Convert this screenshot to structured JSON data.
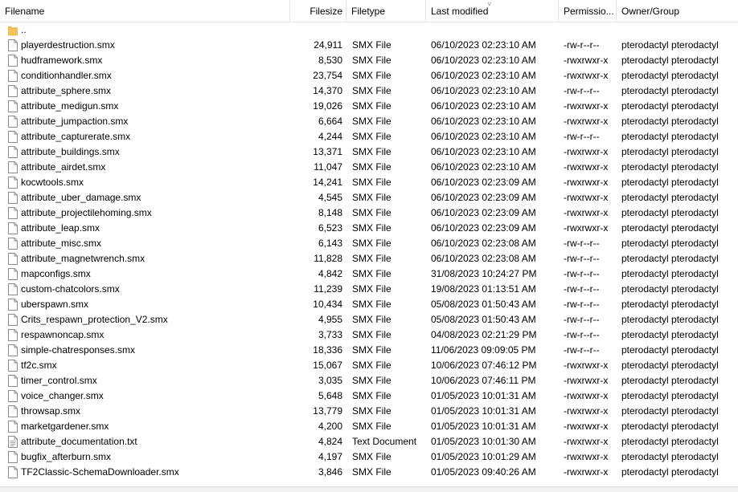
{
  "columns": {
    "filename": "Filename",
    "filesize": "Filesize",
    "filetype": "Filetype",
    "last_modified": "Last modified",
    "permissions": "Permissio...",
    "owner_group": "Owner/Group"
  },
  "sort_indicator": "˅",
  "parent_dir": "..",
  "files": [
    {
      "name": "playerdestruction.smx",
      "size": "24,911",
      "type": "SMX File",
      "modified": "06/10/2023 02:23:10 AM",
      "perm": "-rw-r--r--",
      "owner": "pterodactyl pterodactyl"
    },
    {
      "name": "hudframework.smx",
      "size": "8,530",
      "type": "SMX File",
      "modified": "06/10/2023 02:23:10 AM",
      "perm": "-rwxrwxr-x",
      "owner": "pterodactyl pterodactyl"
    },
    {
      "name": "conditionhandler.smx",
      "size": "23,754",
      "type": "SMX File",
      "modified": "06/10/2023 02:23:10 AM",
      "perm": "-rwxrwxr-x",
      "owner": "pterodactyl pterodactyl"
    },
    {
      "name": "attribute_sphere.smx",
      "size": "14,370",
      "type": "SMX File",
      "modified": "06/10/2023 02:23:10 AM",
      "perm": "-rw-r--r--",
      "owner": "pterodactyl pterodactyl"
    },
    {
      "name": "attribute_medigun.smx",
      "size": "19,026",
      "type": "SMX File",
      "modified": "06/10/2023 02:23:10 AM",
      "perm": "-rwxrwxr-x",
      "owner": "pterodactyl pterodactyl"
    },
    {
      "name": "attribute_jumpaction.smx",
      "size": "6,664",
      "type": "SMX File",
      "modified": "06/10/2023 02:23:10 AM",
      "perm": "-rwxrwxr-x",
      "owner": "pterodactyl pterodactyl"
    },
    {
      "name": "attribute_capturerate.smx",
      "size": "4,244",
      "type": "SMX File",
      "modified": "06/10/2023 02:23:10 AM",
      "perm": "-rw-r--r--",
      "owner": "pterodactyl pterodactyl"
    },
    {
      "name": "attribute_buildings.smx",
      "size": "13,371",
      "type": "SMX File",
      "modified": "06/10/2023 02:23:10 AM",
      "perm": "-rwxrwxr-x",
      "owner": "pterodactyl pterodactyl"
    },
    {
      "name": "attribute_airdet.smx",
      "size": "11,047",
      "type": "SMX File",
      "modified": "06/10/2023 02:23:10 AM",
      "perm": "-rwxrwxr-x",
      "owner": "pterodactyl pterodactyl"
    },
    {
      "name": "kocwtools.smx",
      "size": "14,241",
      "type": "SMX File",
      "modified": "06/10/2023 02:23:09 AM",
      "perm": "-rwxrwxr-x",
      "owner": "pterodactyl pterodactyl"
    },
    {
      "name": "attribute_uber_damage.smx",
      "size": "4,545",
      "type": "SMX File",
      "modified": "06/10/2023 02:23:09 AM",
      "perm": "-rwxrwxr-x",
      "owner": "pterodactyl pterodactyl"
    },
    {
      "name": "attribute_projectilehoming.smx",
      "size": "8,148",
      "type": "SMX File",
      "modified": "06/10/2023 02:23:09 AM",
      "perm": "-rwxrwxr-x",
      "owner": "pterodactyl pterodactyl"
    },
    {
      "name": "attribute_leap.smx",
      "size": "6,523",
      "type": "SMX File",
      "modified": "06/10/2023 02:23:09 AM",
      "perm": "-rwxrwxr-x",
      "owner": "pterodactyl pterodactyl"
    },
    {
      "name": "attribute_misc.smx",
      "size": "6,143",
      "type": "SMX File",
      "modified": "06/10/2023 02:23:08 AM",
      "perm": "-rw-r--r--",
      "owner": "pterodactyl pterodactyl"
    },
    {
      "name": "attribute_magnetwrench.smx",
      "size": "11,828",
      "type": "SMX File",
      "modified": "06/10/2023 02:23:08 AM",
      "perm": "-rw-r--r--",
      "owner": "pterodactyl pterodactyl"
    },
    {
      "name": "mapconfigs.smx",
      "size": "4,842",
      "type": "SMX File",
      "modified": "31/08/2023 10:24:27 PM",
      "perm": "-rw-r--r--",
      "owner": "pterodactyl pterodactyl"
    },
    {
      "name": "custom-chatcolors.smx",
      "size": "11,239",
      "type": "SMX File",
      "modified": "19/08/2023 01:13:51 AM",
      "perm": "-rw-r--r--",
      "owner": "pterodactyl pterodactyl"
    },
    {
      "name": "uberspawn.smx",
      "size": "10,434",
      "type": "SMX File",
      "modified": "05/08/2023 01:50:43 AM",
      "perm": "-rw-r--r--",
      "owner": "pterodactyl pterodactyl"
    },
    {
      "name": "Crits_respawn_protection_V2.smx",
      "size": "4,955",
      "type": "SMX File",
      "modified": "05/08/2023 01:50:43 AM",
      "perm": "-rw-r--r--",
      "owner": "pterodactyl pterodactyl"
    },
    {
      "name": "respawnoncap.smx",
      "size": "3,733",
      "type": "SMX File",
      "modified": "04/08/2023 02:21:29 PM",
      "perm": "-rw-r--r--",
      "owner": "pterodactyl pterodactyl"
    },
    {
      "name": "simple-chatresponses.smx",
      "size": "18,336",
      "type": "SMX File",
      "modified": "11/06/2023 09:09:05 PM",
      "perm": "-rw-r--r--",
      "owner": "pterodactyl pterodactyl"
    },
    {
      "name": "tf2c.smx",
      "size": "15,067",
      "type": "SMX File",
      "modified": "10/06/2023 07:46:12 PM",
      "perm": "-rwxrwxr-x",
      "owner": "pterodactyl pterodactyl"
    },
    {
      "name": "timer_control.smx",
      "size": "3,035",
      "type": "SMX File",
      "modified": "10/06/2023 07:46:11 PM",
      "perm": "-rwxrwxr-x",
      "owner": "pterodactyl pterodactyl"
    },
    {
      "name": "voice_changer.smx",
      "size": "5,648",
      "type": "SMX File",
      "modified": "01/05/2023 10:01:31 AM",
      "perm": "-rwxrwxr-x",
      "owner": "pterodactyl pterodactyl"
    },
    {
      "name": "throwsap.smx",
      "size": "13,779",
      "type": "SMX File",
      "modified": "01/05/2023 10:01:31 AM",
      "perm": "-rwxrwxr-x",
      "owner": "pterodactyl pterodactyl"
    },
    {
      "name": "marketgardener.smx",
      "size": "4,200",
      "type": "SMX File",
      "modified": "01/05/2023 10:01:31 AM",
      "perm": "-rwxrwxr-x",
      "owner": "pterodactyl pterodactyl"
    },
    {
      "name": "attribute_documentation.txt",
      "size": "4,824",
      "type": "Text Document",
      "modified": "01/05/2023 10:01:30 AM",
      "perm": "-rwxrwxr-x",
      "owner": "pterodactyl pterodactyl",
      "icon": "text-file-icon"
    },
    {
      "name": "bugfix_afterburn.smx",
      "size": "4,197",
      "type": "SMX File",
      "modified": "01/05/2023 10:01:29 AM",
      "perm": "-rwxrwxr-x",
      "owner": "pterodactyl pterodactyl"
    },
    {
      "name": "TF2Classic-SchemaDownloader.smx",
      "size": "3,846",
      "type": "SMX File",
      "modified": "01/05/2023 09:40:26 AM",
      "perm": "-rwxrwxr-x",
      "owner": "pterodactyl pterodactyl"
    }
  ],
  "colors": {
    "folder": "#f3c35a",
    "header_border": "#e5e5e5",
    "status_bg": "#f0f0f0"
  }
}
